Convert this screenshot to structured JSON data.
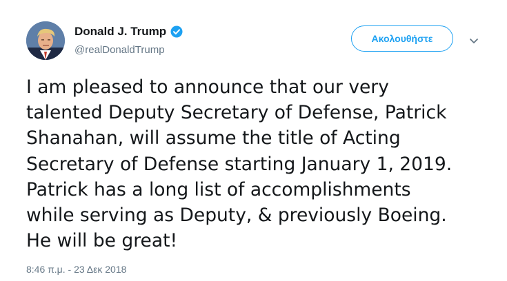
{
  "author": {
    "display_name": "Donald J. Trump",
    "handle": "@realDonaldTrump",
    "verified": true,
    "avatar_icon": "profile-photo"
  },
  "actions": {
    "follow_label": "Ακολουθήστε",
    "menu_icon": "chevron-down-icon"
  },
  "tweet": {
    "lines": [
      "I am pleased to announce that our very",
      "talented Deputy Secretary of Defense, Patrick",
      "Shanahan, will assume the title of Acting",
      "Secretary of Defense starting January 1, 2019.",
      "Patrick has a long list of accomplishments",
      "while serving as Deputy, & previously Boeing.",
      "He will be great!"
    ],
    "timestamp": "8:46 π.μ. - 23 Δεκ 2018"
  },
  "colors": {
    "accent": "#1da1f2",
    "text": "#14171a",
    "secondary": "#657786"
  }
}
